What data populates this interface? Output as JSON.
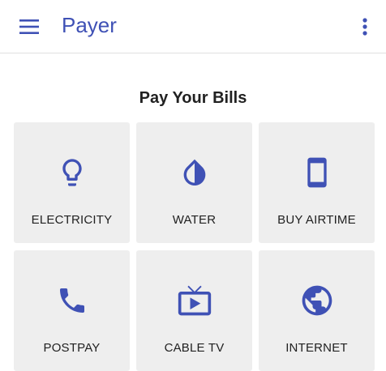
{
  "app": {
    "title": "Payer",
    "accent_color": "#3f51b5",
    "menu_icon": "hamburger-menu-icon",
    "more_icon": "more-vert-icon"
  },
  "main": {
    "heading": "Pay Your Bills",
    "tiles": [
      {
        "label": "ELECTRICITY",
        "icon": "lightbulb-icon"
      },
      {
        "label": "WATER",
        "icon": "water-drop-icon"
      },
      {
        "label": "BUY AIRTIME",
        "icon": "smartphone-icon"
      },
      {
        "label": "POSTPAY",
        "icon": "phone-icon"
      },
      {
        "label": "CABLE TV",
        "icon": "tv-icon"
      },
      {
        "label": "INTERNET",
        "icon": "globe-icon"
      }
    ]
  }
}
